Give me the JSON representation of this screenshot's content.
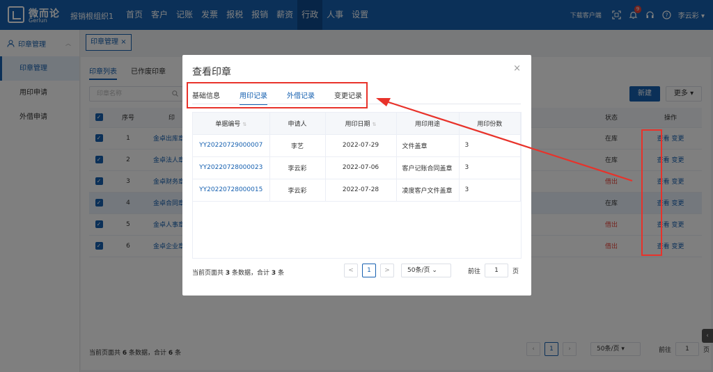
{
  "topbar": {
    "logo_cn": "微而论",
    "logo_en": "Gerlun",
    "org": "报销根组织1",
    "nav": [
      "首页",
      "客户",
      "记账",
      "发票",
      "报税",
      "报销",
      "薪资",
      "行政",
      "人事",
      "设置"
    ],
    "active_nav": "行政",
    "download": "下载客户端",
    "badge_count": "9",
    "user": "李云彩"
  },
  "sidebar": {
    "head": "印章管理",
    "items": [
      "印章管理",
      "用印申请",
      "外借申请"
    ]
  },
  "tab": {
    "label": "印章管理",
    "close": "×"
  },
  "main": {
    "subtabs": [
      "印章列表",
      "已作废印章"
    ],
    "search_placeholder": "印章名称",
    "new_button": "新建",
    "more_button": "更多",
    "headers": {
      "check": "",
      "no": "序号",
      "name": "印",
      "status": "状态",
      "ops": "操作"
    },
    "rows": [
      {
        "no": "1",
        "name": "金卓出库章",
        "status": "在库",
        "status_red": false
      },
      {
        "no": "2",
        "name": "金卓法人章",
        "status": "在库",
        "status_red": false
      },
      {
        "no": "3",
        "name": "金卓财务章",
        "status": "借出",
        "status_red": true
      },
      {
        "no": "4",
        "name": "金卓合同章",
        "status": "在库",
        "status_red": false
      },
      {
        "no": "5",
        "name": "金卓人事章",
        "status": "借出",
        "status_red": true
      },
      {
        "no": "6",
        "name": "金卓企业章",
        "status": "借出",
        "status_red": true
      }
    ],
    "view_label": "查看",
    "change_label": "变更",
    "footer_pre": "当前页面共",
    "footer_count": "6",
    "footer_mid": "条数据，合计",
    "footer_total": "6",
    "footer_post": "条",
    "pager": {
      "page": "1",
      "size": "50条/页",
      "goto": "前往",
      "goto_val": "1",
      "unit": "页"
    }
  },
  "modal": {
    "title": "查看印章",
    "close": "×",
    "tabs": [
      "基础信息",
      "用印记录",
      "外借记录",
      "变更记录"
    ],
    "active_tab": "用印记录",
    "headers": [
      "单据编号",
      "申请人",
      "用印日期",
      "用印用途",
      "用印份数"
    ],
    "rows": [
      {
        "id": "YY20220729000007",
        "applicant": "李艺",
        "date": "2022-07-29",
        "purpose": "文件盖章",
        "copies": "3"
      },
      {
        "id": "YY20220728000023",
        "applicant": "李云彩",
        "date": "2022-07-06",
        "purpose": "客户记账合同盖章",
        "copies": "3"
      },
      {
        "id": "YY20220728000015",
        "applicant": "李云彩",
        "date": "2022-07-28",
        "purpose": "凌度客户文件盖章",
        "copies": "3"
      }
    ],
    "footer_pre": "当前页面共",
    "footer_count": "3",
    "footer_mid": "条数据，合计",
    "footer_total": "3",
    "footer_post": "条",
    "pager": {
      "prev": "<",
      "page": "1",
      "next": ">",
      "size": "50条/页",
      "goto": "前往",
      "goto_val": "1",
      "unit": "页"
    }
  },
  "colors": {
    "brand": "#1660b0",
    "highlight": "#e8322a"
  }
}
